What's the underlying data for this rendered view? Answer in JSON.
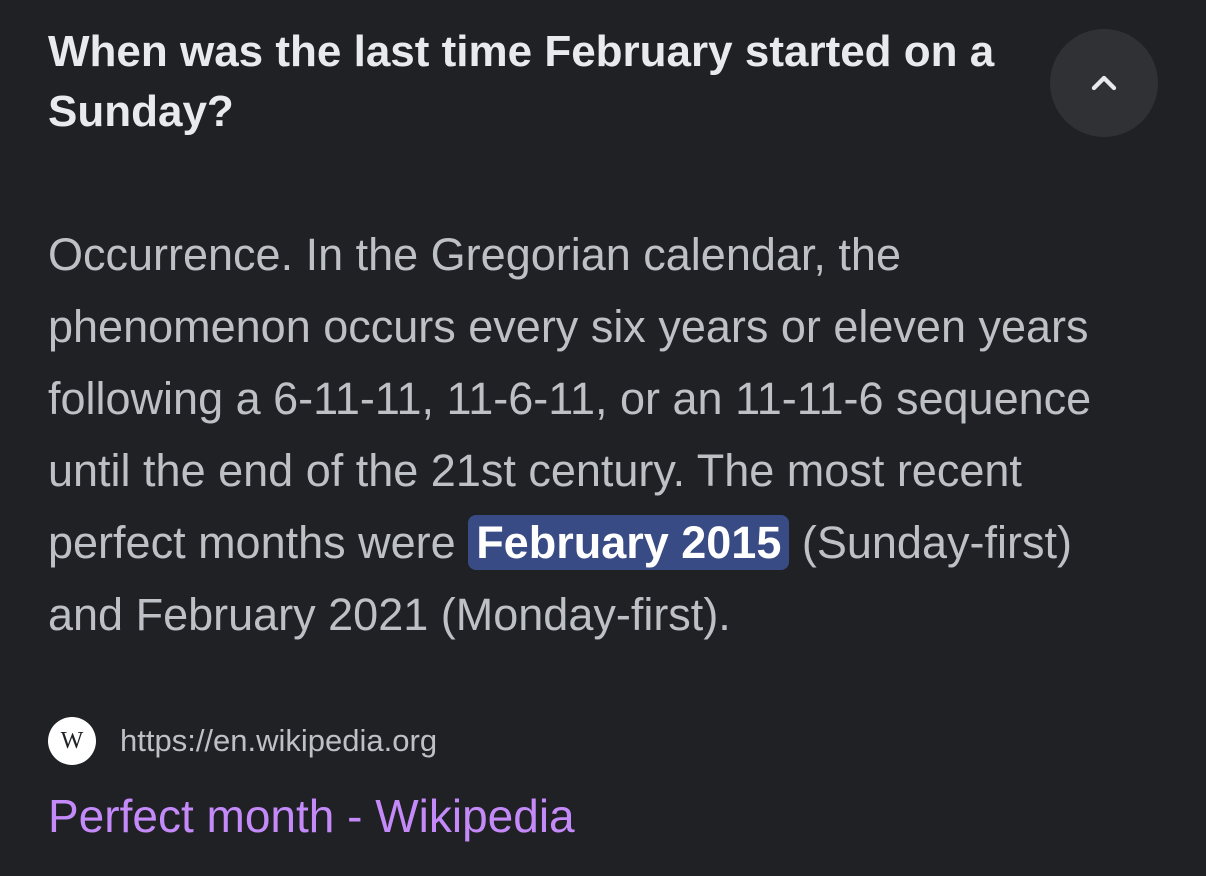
{
  "question": "When was the last time February started on a Sunday?",
  "collapse_button": {
    "icon": "chevron-up-icon"
  },
  "answer": {
    "text_before": "Occurrence. In the Gregorian calendar, the phenomenon occurs every six years or eleven years following a 6-11-11, 11-6-11, or an 11-11-6 sequence until the end of the 21st century. The most recent perfect months were ",
    "highlight": "February 2015",
    "text_after": " (Sunday-first) and February 2021 (Monday-first)."
  },
  "source": {
    "favicon_letter": "W",
    "url": "https://en.wikipedia.org"
  },
  "result_title": "Perfect month - Wikipedia",
  "colors": {
    "background": "#202124",
    "highlight_bg": "#394b84",
    "link": "#c58af9"
  }
}
